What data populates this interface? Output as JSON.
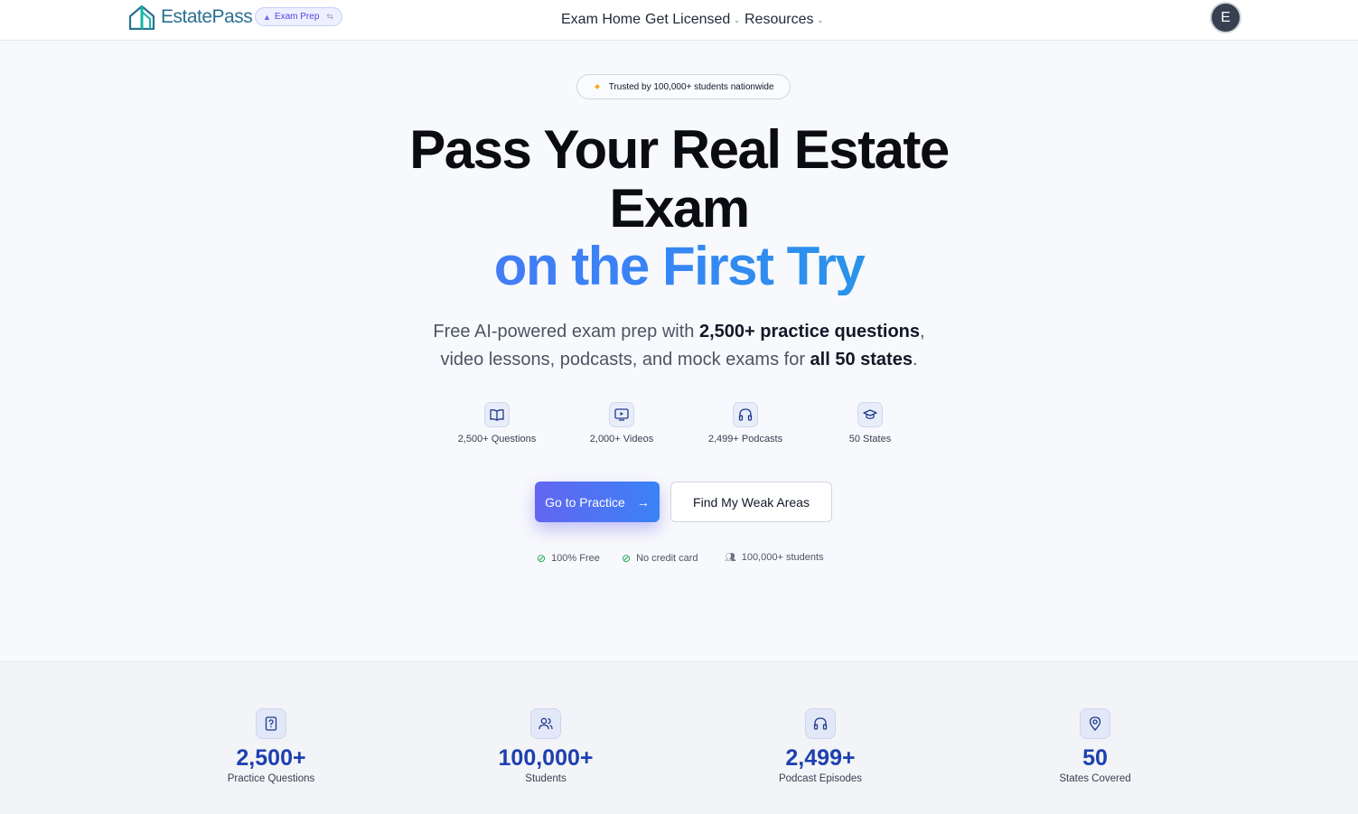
{
  "header": {
    "brand": "EstatePass",
    "badge": "Exam Prep",
    "nav": [
      {
        "label": "Exam Home"
      },
      {
        "label": "Get Licensed"
      },
      {
        "label": "Resources"
      }
    ],
    "avatar_initial": "E"
  },
  "hero": {
    "trust": "Trusted by 100,000+ students nationwide",
    "title_line1": "Pass Your Real Estate",
    "title_line2": "Exam",
    "title_line3": "on the First Try",
    "sub1_a": "Free AI-powered exam prep with ",
    "sub1_b": "2,500+ practice questions",
    "sub1_c": ",",
    "sub2_a": "video lessons, podcasts, and mock exams for ",
    "sub2_b": "all 50 states",
    "sub2_c": ".",
    "features": [
      {
        "label": "2,500+ Questions",
        "icon": "book-icon"
      },
      {
        "label": "2,000+ Videos",
        "icon": "video-icon"
      },
      {
        "label": "2,499+ Podcasts",
        "icon": "headphones-icon"
      },
      {
        "label": "50 States",
        "icon": "graduation-cap-icon"
      }
    ],
    "primary_cta": "Go to Practice",
    "secondary_cta": "Find My Weak Areas",
    "perks": [
      {
        "label": "100% Free",
        "icon": "check-icon"
      },
      {
        "label": "No credit card",
        "icon": "check-icon"
      },
      {
        "label": "100,000+ students",
        "icon": "users-icon"
      }
    ]
  },
  "stats": [
    {
      "value": "2,500+",
      "caption": "Practice Questions",
      "icon": "question-file-icon"
    },
    {
      "value": "100,000+",
      "caption": "Students",
      "icon": "users-icon"
    },
    {
      "value": "2,499+",
      "caption": "Podcast Episodes",
      "icon": "headphones-icon"
    },
    {
      "value": "50",
      "caption": "States Covered",
      "icon": "map-pin-icon"
    }
  ],
  "colors": {
    "accent": "#4f46e5",
    "gradient_start": "#6366f1",
    "gradient_end": "#06b6d4",
    "stat_number": "#1e40af"
  }
}
